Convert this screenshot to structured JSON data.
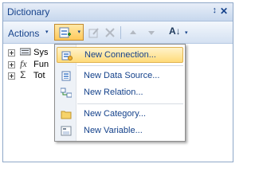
{
  "panel": {
    "title": "Dictionary",
    "pin_glyph": "↕",
    "close_glyph": "✕"
  },
  "toolbar": {
    "actions_label": "Actions",
    "dropdown_glyph": "▾",
    "sort_glyph": "A↓"
  },
  "tree": {
    "items": [
      {
        "label": "Sys",
        "icon": "database-icon"
      },
      {
        "label": "Fun",
        "icon": "function-icon"
      },
      {
        "label": "Tot",
        "icon": "sigma-icon"
      }
    ]
  },
  "menu": {
    "items": [
      {
        "label": "New Connection...",
        "icon": "connection-icon",
        "active": true
      },
      {
        "label": "New Data Source...",
        "icon": "data-source-icon"
      },
      {
        "label": "New Relation...",
        "icon": "relation-icon"
      },
      {
        "label": "New Category...",
        "icon": "folder-icon"
      },
      {
        "label": "New Variable...",
        "icon": "variable-icon"
      }
    ]
  },
  "colors": {
    "accent_highlight": "#ffdb7a",
    "title_text": "#15428b",
    "header_bg": "#c7d7ed"
  }
}
